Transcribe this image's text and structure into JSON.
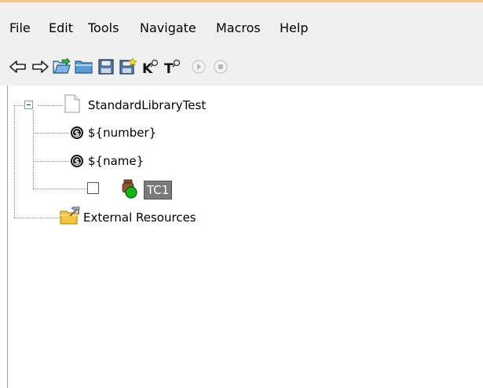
{
  "menubar": {
    "items": [
      "File",
      "Edit",
      "Tools",
      "Navigate",
      "Macros",
      "Help"
    ]
  },
  "toolbar": {
    "buttons": [
      {
        "icon": "back-arrow-icon"
      },
      {
        "icon": "forward-arrow-icon"
      },
      {
        "icon": "open-directory-icon"
      },
      {
        "icon": "folder-icon"
      },
      {
        "icon": "save-icon"
      },
      {
        "icon": "save-all-icon"
      },
      {
        "icon": "search-keywords-icon",
        "label": "K"
      },
      {
        "icon": "search-tests-icon",
        "label": "T"
      },
      {
        "icon": "run-icon"
      },
      {
        "icon": "stop-icon"
      }
    ]
  },
  "tree": {
    "root": {
      "label": "StandardLibraryTest"
    },
    "children": [
      {
        "label": "${number}",
        "icon": "variable-dollar-icon"
      },
      {
        "label": "${name}",
        "icon": "variable-dollar-icon"
      },
      {
        "label": "TC1",
        "icon": "test-case-icon",
        "selected": true
      }
    ],
    "external": {
      "label": "External Resources"
    }
  },
  "colors": {
    "chrome": "#f0f0f0",
    "selection": "#7a7a7a",
    "accent_line": "#f0c68a"
  }
}
